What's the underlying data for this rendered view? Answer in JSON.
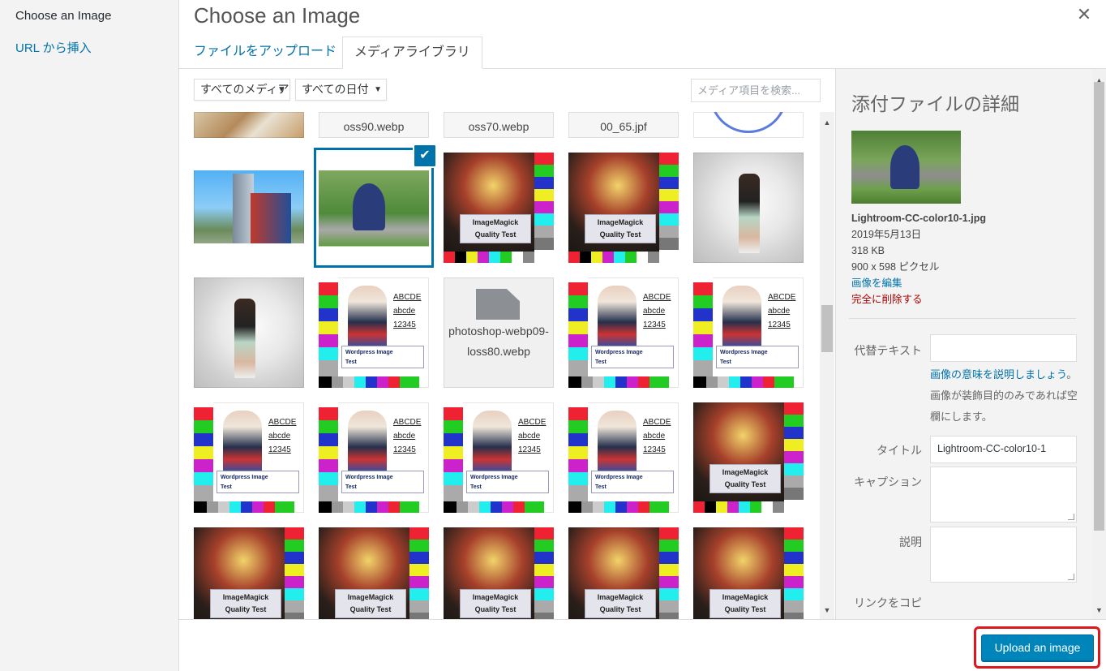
{
  "menu": {
    "title": "Choose an Image",
    "insert_url": "URL から挿入"
  },
  "frame": {
    "title": "Choose an Image",
    "close_glyph": "✕"
  },
  "tabs": {
    "upload": "ファイルをアップロード",
    "library": "メディアライブラリ"
  },
  "toolbar": {
    "type_filter": "すべてのメディア",
    "date_filter": "すべての日付",
    "caret": "▼",
    "search_placeholder": "メディア項目を検索..."
  },
  "grid": {
    "partial_row": [
      "",
      "oss90.webp",
      "oss70.webp",
      "00_65.jpf",
      ""
    ],
    "generic_file_name": "photoshop-webp09-loss80.webp",
    "magick_label_1": "ImageMagick",
    "magick_label_2": "Quality Test",
    "wp_abc_1": "ABCDE",
    "wp_abc_2": "abcde",
    "wp_abc_3": "12345",
    "wp_label_1": "Wordpress Image",
    "wp_label_2": "Test",
    "check_glyph": "✔"
  },
  "details": {
    "title": "添付ファイルの詳細",
    "filename": "Lightroom-CC-color10-1.jpg",
    "date": "2019年5月13日",
    "size": "318 KB",
    "dimensions": "900 x 598 ピクセル",
    "edit_link": "画像を編集",
    "delete_link": "完全に削除する",
    "alt_label": "代替テキスト",
    "alt_value": "",
    "alt_help_link": "画像の意味を説明しましょう",
    "alt_help_text": "。画像が装飾目的のみであれば空欄にします。",
    "title_label": "タイトル",
    "title_value": "Lightroom-CC-color10-1",
    "caption_label": "キャプション",
    "caption_value": "",
    "description_label": "説明",
    "description_value": "",
    "copy_link_label": "リンクをコピー"
  },
  "footer": {
    "upload_button": "Upload an image"
  },
  "colors": {
    "accent": "#0073aa",
    "button": "#0085ba",
    "delete": "#a00000",
    "highlight": "#e0161d"
  }
}
